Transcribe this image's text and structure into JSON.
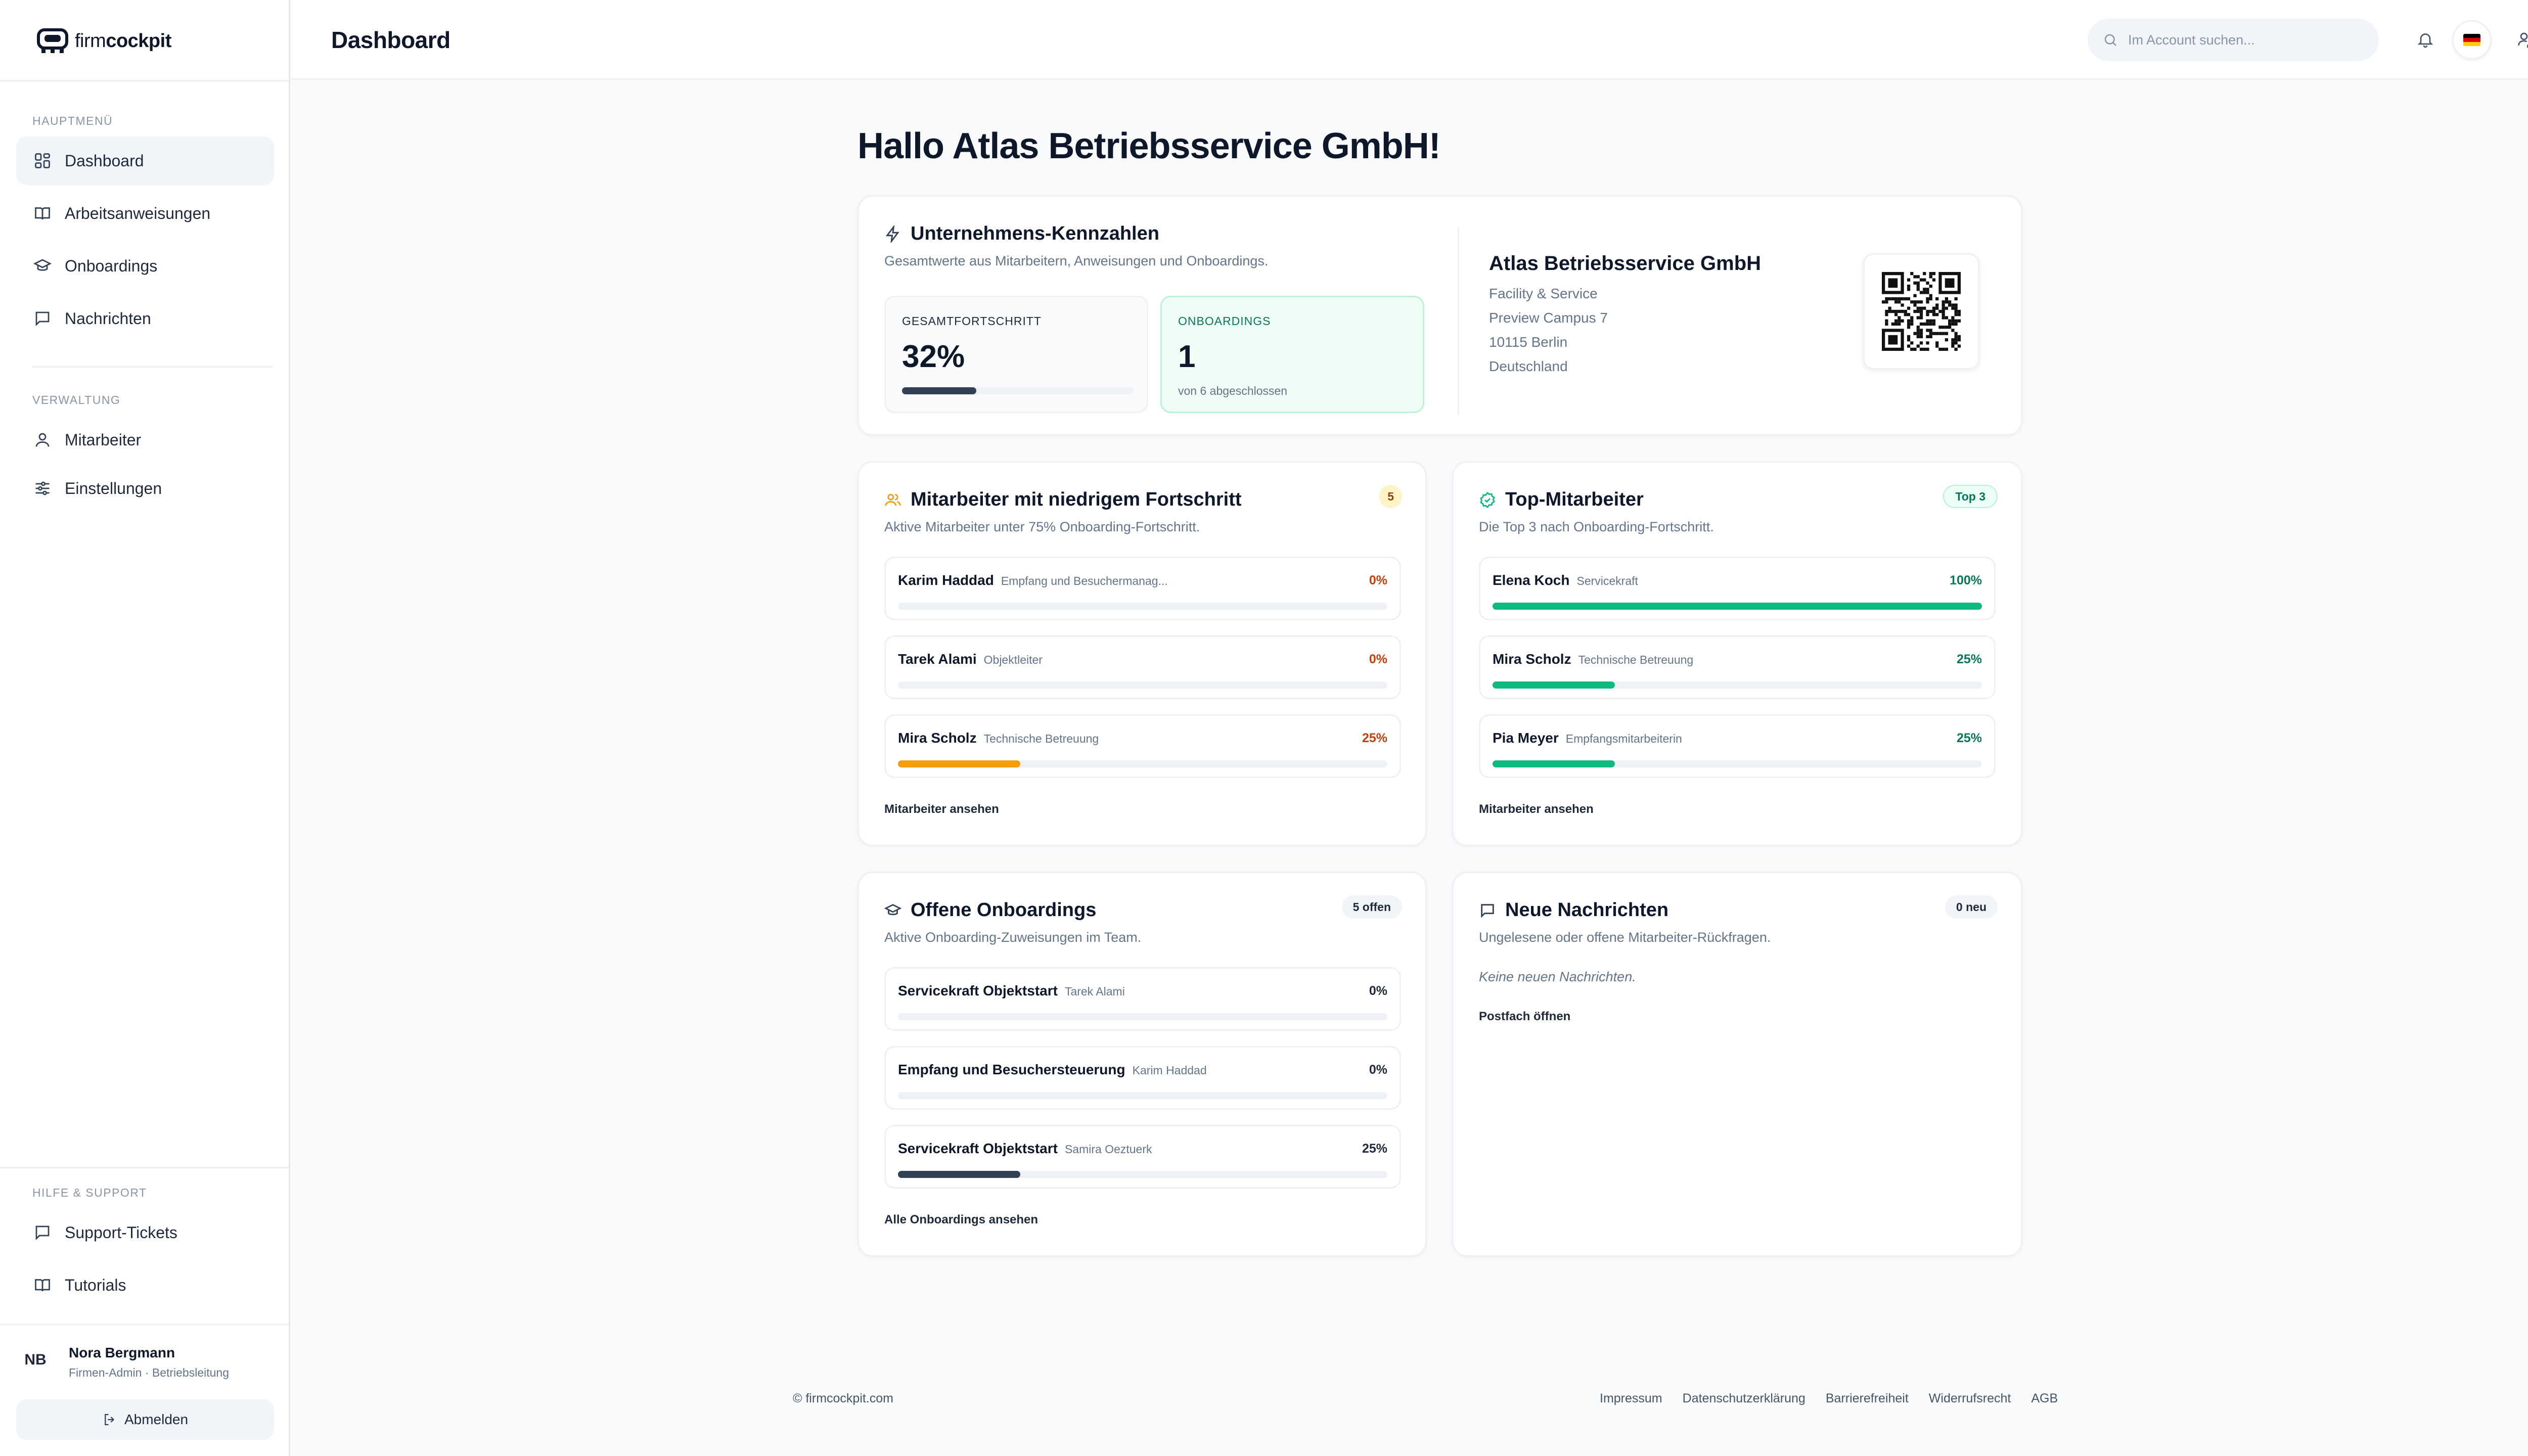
{
  "brand": {
    "name_light": "firm",
    "name_bold": "cockpit"
  },
  "sidebar": {
    "main_title": "HAUPTMENÜ",
    "main_items": [
      {
        "label": "Dashboard",
        "icon": "grid-icon",
        "active": true
      },
      {
        "label": "Arbeitsanweisungen",
        "icon": "book-icon"
      },
      {
        "label": "Onboardings",
        "icon": "graduation-cap-icon"
      },
      {
        "label": "Nachrichten",
        "icon": "chat-icon"
      }
    ],
    "admin_title": "VERWALTUNG",
    "admin_items": [
      {
        "label": "Mitarbeiter",
        "icon": "user-icon"
      },
      {
        "label": "Einstellungen",
        "icon": "sliders-icon"
      }
    ],
    "help_title": "HILFE & SUPPORT",
    "help_items": [
      {
        "label": "Support-Tickets",
        "icon": "chat-icon"
      },
      {
        "label": "Tutorials",
        "icon": "book-icon"
      }
    ],
    "user": {
      "initials": "NB",
      "name": "Nora Bergmann",
      "role": "Firmen-Admin · Betriebsleitung"
    },
    "logout_label": "Abmelden"
  },
  "topbar": {
    "title": "Dashboard",
    "search_placeholder": "Im Account suchen...",
    "icons": [
      "bell-icon",
      "german-flag-icon",
      "user-settings-icon"
    ]
  },
  "greeting": "Hallo Atlas Betriebsservice GmbH!",
  "kpi_card": {
    "title": "Unternehmens-Kennzahlen",
    "subtitle": "Gesamtwerte aus Mitarbeitern, Anweisungen und Onboardings.",
    "progress_label": "GESAMTFORTSCHRITT",
    "progress_value": "32%",
    "progress_fraction": 0.32,
    "onboardings_label": "ONBOARDINGS",
    "onboardings_value": "1",
    "onboardings_note": "von 6 abgeschlossen",
    "company": {
      "name": "Atlas Betriebsservice GmbH",
      "lines": [
        "Facility & Service",
        "Preview Campus 7",
        "10115 Berlin",
        "Deutschland"
      ]
    }
  },
  "low_progress": {
    "title": "Mitarbeiter mit niedrigem Fortschritt",
    "badge": "5",
    "subtitle": "Aktive Mitarbeiter unter 75% Onboarding-Fortschritt.",
    "rows": [
      {
        "name": "Karim Haddad",
        "meta": "Empfang und Besuchermanag...",
        "pct": "0%",
        "value": 0
      },
      {
        "name": "Tarek Alami",
        "meta": "Objektleiter",
        "pct": "0%",
        "value": 0
      },
      {
        "name": "Mira Scholz",
        "meta": "Technische Betreuung",
        "pct": "25%",
        "value": 0.25
      }
    ],
    "link": "Mitarbeiter ansehen"
  },
  "top_staff": {
    "title": "Top-Mitarbeiter",
    "badge": "Top 3",
    "subtitle": "Die Top 3 nach Onboarding-Fortschritt.",
    "rows": [
      {
        "name": "Elena Koch",
        "meta": "Servicekraft",
        "pct": "100%",
        "value": 1
      },
      {
        "name": "Mira Scholz",
        "meta": "Technische Betreuung",
        "pct": "25%",
        "value": 0.25
      },
      {
        "name": "Pia Meyer",
        "meta": "Empfangsmitarbeiterin",
        "pct": "25%",
        "value": 0.25
      }
    ],
    "link": "Mitarbeiter ansehen"
  },
  "open_onboardings": {
    "title": "Offene Onboardings",
    "badge": "5 offen",
    "subtitle": "Aktive Onboarding-Zuweisungen im Team.",
    "rows": [
      {
        "name": "Servicekraft Objektstart",
        "meta": "Tarek Alami",
        "pct": "0%",
        "value": 0
      },
      {
        "name": "Empfang und Besuchersteuerung",
        "meta": "Karim Haddad",
        "pct": "0%",
        "value": 0
      },
      {
        "name": "Servicekraft Objektstart",
        "meta": "Samira Oeztuerk",
        "pct": "25%",
        "value": 0.25
      }
    ],
    "link": "Alle Onboardings ansehen"
  },
  "messages": {
    "title": "Neue Nachrichten",
    "badge": "0 neu",
    "subtitle": "Ungelesene oder offene Mitarbeiter-Rückfragen.",
    "empty": "Keine neuen Nachrichten.",
    "link": "Postfach öffnen"
  },
  "footer": {
    "copyright": "© firmcockpit.com",
    "links": [
      "Impressum",
      "Datenschutzerklärung",
      "Barrierefreiheit",
      "Widerrufsrecht",
      "AGB"
    ]
  },
  "colors": {
    "accent_dark": "#334155",
    "success": "#10b981",
    "warning": "#f59e0b",
    "danger_text": "#c2410c",
    "success_text": "#047857"
  }
}
